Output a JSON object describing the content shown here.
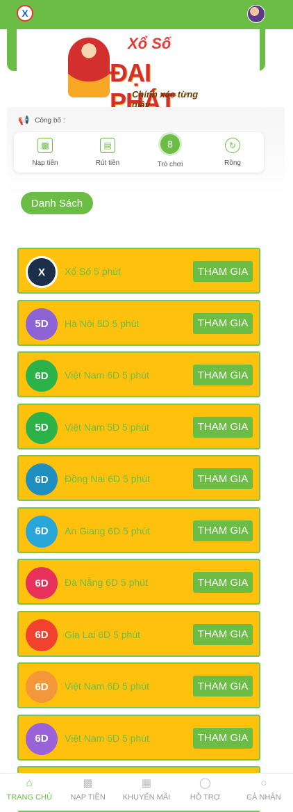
{
  "header": {
    "logo_icon": "x-logo-icon",
    "avatar_icon": "user-avatar"
  },
  "brand": {
    "title_top": "Xổ Số",
    "title_main": "ĐẠI PHÁT",
    "slogan": "Chính xác từng giây"
  },
  "notice": {
    "icon": "megaphone-icon",
    "label": "Công bố :"
  },
  "quick_actions": [
    {
      "label": "Nạp tiền",
      "icon": "deposit-icon"
    },
    {
      "label": "Rút tiền",
      "icon": "withdraw-icon"
    },
    {
      "label": "Trò chơi",
      "icon": "game-icon"
    },
    {
      "label": "Rồng",
      "icon": "dragon-icon"
    }
  ],
  "list_button": "Danh Sách",
  "games": [
    {
      "name": "Xổ Số 5 phút",
      "button": "THAM GIA",
      "icon_color": "#1c2f4a"
    },
    {
      "name": "Hà Nội 5D 5 phút",
      "button": "THAM GIA",
      "icon_color": "#8e63d6"
    },
    {
      "name": "Việt Nam 6D 5 phút",
      "button": "THAM GIA",
      "icon_color": "#2bb34a"
    },
    {
      "name": "Việt Nam 5D 5 phút",
      "button": "THAM GIA",
      "icon_color": "#2bb34a"
    },
    {
      "name": "Đồng Nai 6D 5 phút",
      "button": "THAM GIA",
      "icon_color": "#1f8fc2"
    },
    {
      "name": "An Giang 6D 5 phút",
      "button": "THAM GIA",
      "icon_color": "#2aa5d8"
    },
    {
      "name": "Đà Nẵng 6D 5 phút",
      "button": "THAM GIA",
      "icon_color": "#e8315a"
    },
    {
      "name": "Gia Lai 6D 5 phút",
      "button": "THAM GIA",
      "icon_color": "#f0422e"
    },
    {
      "name": "Việt Nam 6D 5 phút",
      "button": "THAM GIA",
      "icon_color": "#f4973b"
    },
    {
      "name": "Việt Nam 6D 5 phút",
      "button": "THAM GIA",
      "icon_color": "#9a62d9"
    }
  ],
  "bottom_nav": [
    {
      "label": "TRANG CHỦ",
      "icon": "home-icon",
      "active": true
    },
    {
      "label": "NẠP TIỀN",
      "icon": "deposit-icon",
      "active": false
    },
    {
      "label": "KHUYẾN MÃI",
      "icon": "gift-icon",
      "active": false
    },
    {
      "label": "HỖ TRỢ",
      "icon": "headset-icon",
      "active": false
    },
    {
      "label": "CÁ NHÂN",
      "icon": "user-icon",
      "active": false
    }
  ],
  "colors": {
    "primary_green": "#6cbd45",
    "card_yellow": "#fec10e"
  }
}
